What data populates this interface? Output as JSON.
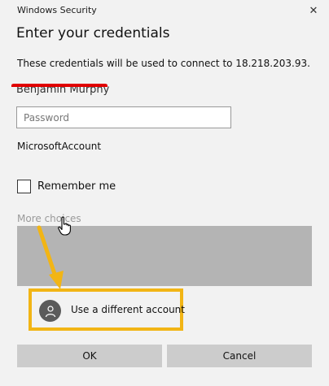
{
  "window": {
    "title": "Windows Security",
    "close_glyph": "✕"
  },
  "dialog": {
    "heading": "Enter your credentials",
    "description": "These credentials will be used to connect to 18.218.203.93.",
    "username": "Benjamin Murphy",
    "password_placeholder": "Password",
    "account_type": "MicrosoftAccount",
    "remember_label": "Remember me",
    "remember_checked": false,
    "more_choices_label": "More choices",
    "alt_account_label": "Use a different account"
  },
  "buttons": {
    "ok": "OK",
    "cancel": "Cancel"
  },
  "colors": {
    "highlight": "#f2b515",
    "redaction": "#e00000",
    "panel": "#b4b4b4",
    "button": "#cccccc",
    "background": "#f2f2f2"
  },
  "icons": {
    "close": "close-icon",
    "avatar": "person-icon",
    "cursor": "hand-cursor-icon",
    "annotation": "arrow-icon"
  }
}
